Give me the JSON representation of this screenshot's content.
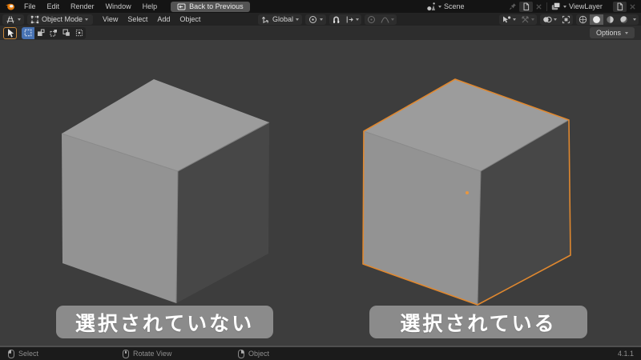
{
  "topbar": {
    "menus": [
      "File",
      "Edit",
      "Render",
      "Window",
      "Help"
    ],
    "back_button_label": "Back to Previous",
    "scene_selector": {
      "value": "Scene"
    },
    "view_layer_selector": {
      "value": "ViewLayer"
    }
  },
  "viewport_header": {
    "mode_dropdown_value": "Object Mode",
    "menus": [
      "View",
      "Select",
      "Add",
      "Object"
    ],
    "orientation_dropdown_value": "Global"
  },
  "tool_settings": {
    "options_button_label": "Options"
  },
  "viewport": {
    "unselected_cube_label": "選択されていない",
    "selected_cube_label": "選択されている"
  },
  "status_bar": {
    "left_mouse_hint": "Select",
    "middle_mouse_hint": "Rotate View",
    "right_mouse_hint": "Object",
    "version": "4.1.1"
  },
  "colors": {
    "selection_outline_orange": "#e0882f",
    "tool_mode_active_blue": "#4772b3",
    "viewport_background": "#3d3d3d",
    "cube_top_face": "#9c9c9c",
    "cube_front_face": "#939393",
    "cube_side_face": "#474747",
    "label_background": "#8b8b8b",
    "label_text": "#ffffff"
  },
  "icons": {
    "close_glyph": "✕"
  }
}
